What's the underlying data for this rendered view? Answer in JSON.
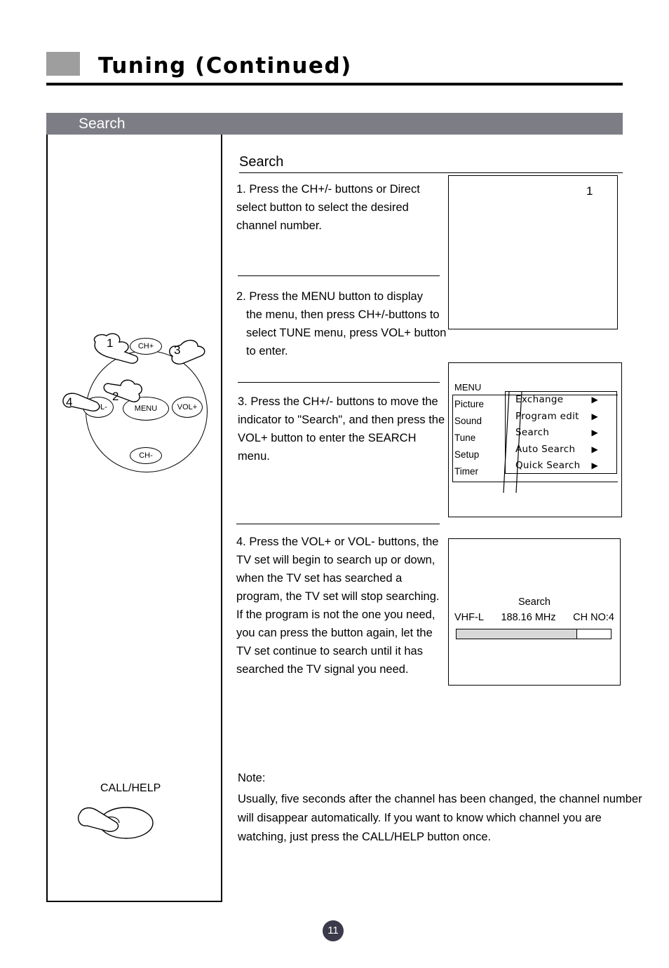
{
  "header": {
    "title": "Tuning (Continued)",
    "section_label": "Search"
  },
  "main": {
    "sub_heading": "Search",
    "steps": [
      {
        "id": "step1",
        "text": "1. Press the CH+/- buttons or Direct select button to select the desired channel number."
      },
      {
        "id": "step2",
        "lead": "2. Press the MENU button to display",
        "rest": "the menu, then press CH+/-buttons to select TUNE menu, press VOL+ button to enter."
      },
      {
        "id": "step3",
        "text": "3. Press the CH+/- buttons to move the indicator to \"Search\", and then press the VOL+ button to enter the SEARCH menu."
      },
      {
        "id": "step4",
        "text": "4. Press the VOL+ or VOL- buttons, the TV set will begin to search up or down, when the TV set has searched a program, the TV set will stop searching. If the program is not the one you need, you can press the button again, let the TV set continue to search until it has searched the TV signal you need."
      }
    ],
    "note": {
      "title": "Note:",
      "body": "Usually, five seconds after the channel has been changed, the channel number will disappear automatically. If you want to know which channel you are watching, just press the CALL/HELP button once."
    }
  },
  "screens": {
    "screen1": {
      "number": "1"
    },
    "osd": {
      "menu_label": "MENU",
      "left_items": [
        "Picture",
        "Sound",
        "Tune",
        "Setup",
        "Timer"
      ],
      "right_items": [
        {
          "label": "Exchange",
          "arrow": "▶"
        },
        {
          "label": "Program edit",
          "arrow": "▶"
        },
        {
          "label": "Search",
          "arrow": "▶"
        },
        {
          "label": "Auto Search",
          "arrow": "▶"
        },
        {
          "label": "Quick Search",
          "arrow": "▶"
        }
      ]
    },
    "search_screen": {
      "title": "Search",
      "band": "VHF-L",
      "frequency": "188.16 MHz",
      "channel": "CH NO:4",
      "progress_percent": 78
    }
  },
  "control_panel": {
    "buttons": {
      "menu": "MENU",
      "ch_plus": "CH+",
      "ch_minus": "CH-",
      "vol_plus": "VOL+",
      "vol_minus": "VOL-"
    },
    "callouts": [
      "1",
      "2",
      "3",
      "4"
    ]
  },
  "call_help": {
    "label": "CALL/HELP"
  },
  "footer": {
    "page_number": "11"
  },
  "colors": {
    "section_bar": "#7d7d85",
    "header_block": "#9e9e9e",
    "page_badge": "#3a3a4a",
    "progress_fill": "#d8d8d8"
  }
}
